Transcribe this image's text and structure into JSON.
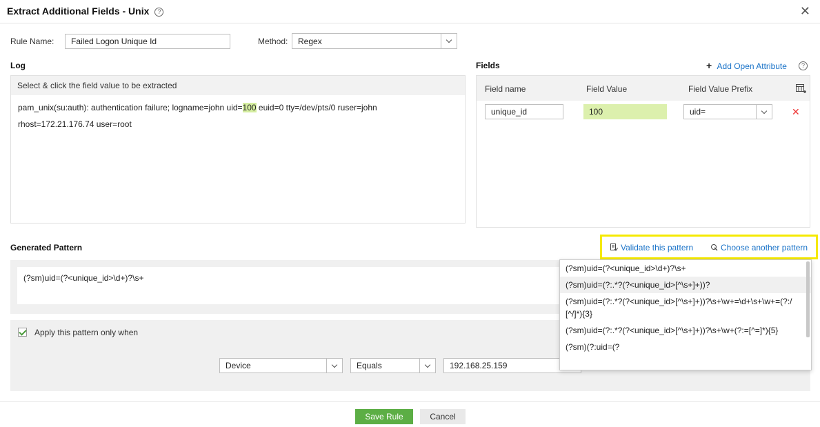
{
  "dialog": {
    "title": "Extract Additional Fields - Unix",
    "help_glyph": "?"
  },
  "rule": {
    "name_label": "Rule Name:",
    "name_value": "Failed Logon Unique Id",
    "method_label": "Method:",
    "method_value": "Regex"
  },
  "log": {
    "heading": "Log",
    "instruction": "Select & click the field value to be extracted",
    "line1_before": "pam_unix(su:auth): authentication failure; logname=john uid=",
    "line1_highlight": "100",
    "line1_after": " euid=0 tty=/dev/pts/0 ruser=john",
    "line2": "rhost=172.21.176.74 user=root"
  },
  "fields": {
    "heading": "Fields",
    "add_label": "Add Open Attribute",
    "col_name": "Field name",
    "col_value": "Field Value",
    "col_prefix": "Field Value Prefix",
    "rows": [
      {
        "name": "unique_id",
        "value": "100",
        "prefix": "uid="
      }
    ]
  },
  "pattern": {
    "heading": "Generated Pattern",
    "validate_label": "Validate this pattern",
    "choose_label": "Choose another pattern",
    "value": "(?sm)uid=(?<unique_id>\\d+)?\\s+",
    "options": [
      "(?sm)uid=(?<unique_id>\\d+)?\\s+",
      "(?sm)uid=(?:.*?(?<unique_id>[^\\s+]+))?",
      "(?sm)uid=(?:.*?(?<unique_id>[^\\s+]+))?\\s+\\w+=\\d+\\s+\\w+=(?:/[^/]*){3}",
      "(?sm)uid=(?:.*?(?<unique_id>[^\\s+]+))?\\s+\\w+(?:=[^=]*){5}",
      "(?sm)(?:uid=(?"
    ]
  },
  "condition": {
    "apply_label": "Apply this pattern only when",
    "field": "Device",
    "operator": "Equals",
    "value": "192.168.25.159"
  },
  "buttons": {
    "save": "Save Rule",
    "cancel": "Cancel"
  },
  "colors": {
    "highlight": "#d5eea0",
    "link": "#1a73c8",
    "save": "#5cae45",
    "callout": "#f5e900",
    "delete": "#e33333"
  }
}
